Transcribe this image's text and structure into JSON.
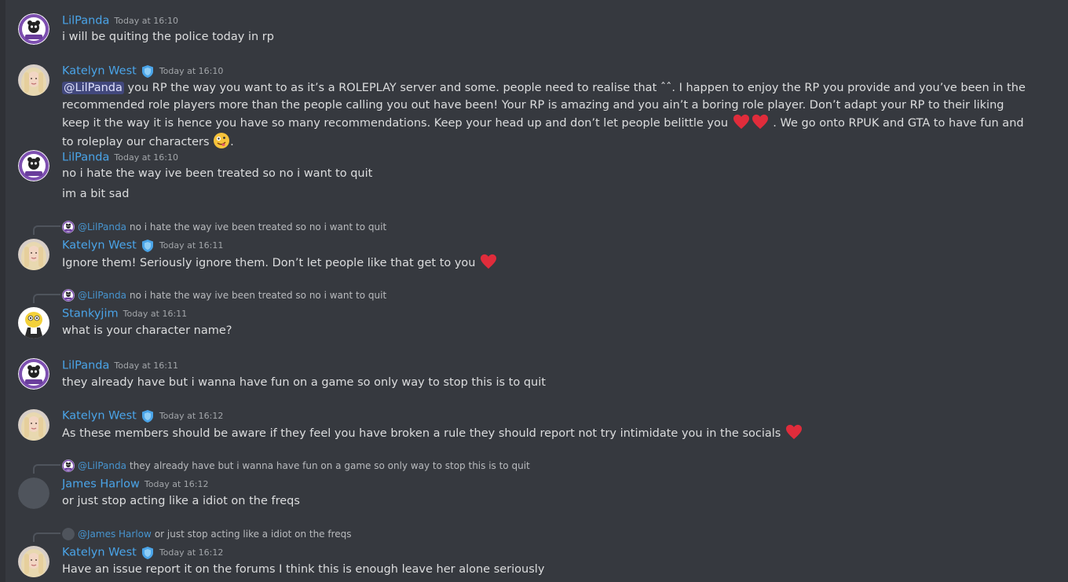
{
  "colors": {
    "background": "#36393f",
    "username": "#4aa4e8",
    "text": "#dcddde",
    "timestamp": "#a3a6aa",
    "heart": "#e02c3b"
  },
  "messages": [
    {
      "author": "LilPanda",
      "timestamp": "Today at 16:10",
      "avatar_icon": "panda-avatar",
      "lines": [
        "i will be quiting the police today in rp"
      ]
    },
    {
      "author": "Katelyn West",
      "badge_icon": "verified-shield-icon",
      "timestamp": "Today at 16:10",
      "avatar_icon": "woman-avatar",
      "mention": "@LilPanda",
      "text_part1": " you RP the way you want to as it’s a ROLEPLAY server and some.  people need to realise that ˆˆ. I happen to enjoy the RP you provide and you’ve been in the recommended role players more than the people calling you out have been! Your RP is amazing and you ain’t a boring role player. Don’t adapt your RP to their liking keep it the way it is hence you have so many recommendations. Keep your head up and don’t let people belittle you ",
      "text_part2": " . We go onto RPUK and GTA to have fun and to roleplay our characters ",
      "text_part3": "."
    },
    {
      "author": "LilPanda",
      "timestamp": "Today at 16:10",
      "lines": [
        "no i hate the way ive been treated so no i want to quit",
        "im a bit sad"
      ]
    },
    {
      "reply_user": "@LilPanda",
      "reply_text": "no i hate the way ive been treated so no i want to quit",
      "author": "Katelyn West",
      "timestamp": "Today at 16:11",
      "lines": [
        "Ignore them! Seriously ignore them. Don’t let people like that get to you"
      ]
    },
    {
      "reply_user": "@LilPanda",
      "reply_text": "no i hate the way ive been treated so no i want to quit",
      "author": "Stankyjim",
      "timestamp": "Today at 16:11",
      "avatar_icon": "cartoon-avatar",
      "lines": [
        "what is your character name?"
      ]
    },
    {
      "author": "LilPanda",
      "timestamp": "Today at 16:11",
      "lines": [
        "they already have but i wanna have fun on a game so only way to stop this is to quit"
      ]
    },
    {
      "author": "Katelyn West",
      "timestamp": "Today at 16:12",
      "lines": [
        "As these members should be aware if they feel you have broken a rule they should report not try intimidate you in the socials"
      ]
    },
    {
      "reply_user": "@LilPanda",
      "reply_text": "they already have but i wanna have fun on a game so only way to stop this is to quit",
      "author": "James Harlow",
      "timestamp": "Today at 16:12",
      "avatar_icon": "default-grey-avatar",
      "lines": [
        "or just stop acting like a idiot on the freqs"
      ]
    },
    {
      "reply_user": "@James Harlow",
      "reply_text": "or just stop acting like a idiot on the freqs",
      "author": "Katelyn West",
      "timestamp": "Today at 16:12",
      "lines": [
        "Have an issue report it on the forums I think this is enough leave her alone seriously"
      ]
    }
  ]
}
